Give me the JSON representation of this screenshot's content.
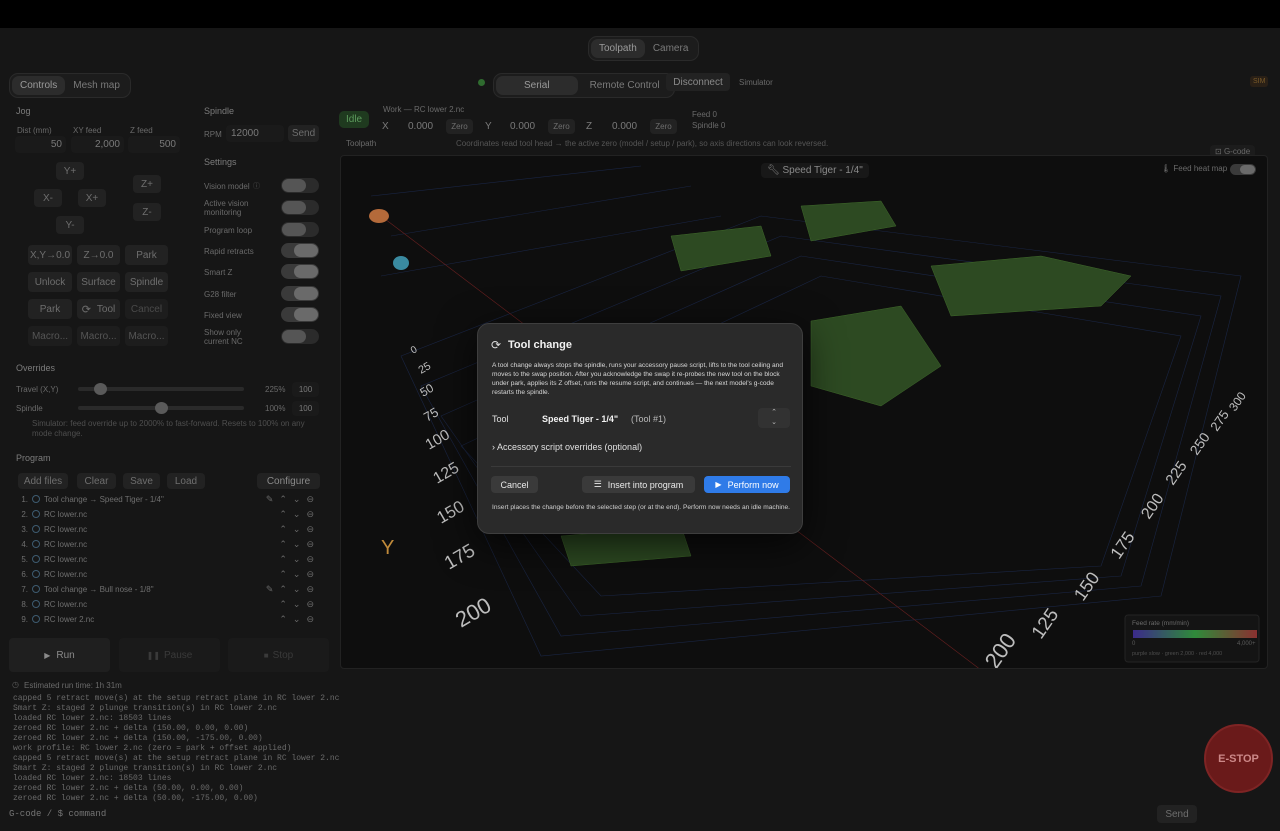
{
  "view_tabs": [
    "Toolpath",
    "Camera"
  ],
  "left_tabs": [
    "Controls",
    "Mesh map"
  ],
  "connection": {
    "tabs": [
      "Serial",
      "Remote Control"
    ],
    "disconnect": "Disconnect",
    "mode": "Simulator",
    "badge": "SIM"
  },
  "jog": {
    "title": "Jog",
    "dist_label": "Dist (mm)",
    "xy_label": "XY feed",
    "z_label": "Z feed",
    "dist": "50",
    "xy": "2,000",
    "z": "500",
    "axes": [
      "Y+",
      "X-",
      "X+",
      "Y-",
      "Z+",
      "Z-"
    ],
    "buttons": [
      "X,Y→0.0",
      "Z→0.0",
      "Park",
      "Unlock",
      "Surface",
      "Spindle",
      "Park",
      "Tool",
      "Cancel",
      "Macro...",
      "Macro...",
      "Macro..."
    ]
  },
  "spindle": {
    "title": "Spindle",
    "rpm_label": "RPM",
    "rpm": "12000",
    "send": "Send"
  },
  "settings": {
    "title": "Settings",
    "items": [
      "Vision model",
      "Active vision monitoring",
      "Program loop",
      "Rapid retracts",
      "Smart Z",
      "G28 filter",
      "Fixed view",
      "Show only current NC"
    ]
  },
  "overrides": {
    "title": "Overrides",
    "travel_label": "Travel (X,Y)",
    "travel_pct": "225%",
    "travel_val": "100",
    "spindle_label": "Spindle",
    "spindle_pct": "100%",
    "spindle_val": "100",
    "note": "Simulator: feed override up to 2000% to fast-forward. Resets to 100% on any mode change."
  },
  "program": {
    "title": "Program",
    "buttons": [
      "Add files",
      "Clear",
      "Save",
      "Load"
    ],
    "configure": "Configure",
    "rows": [
      {
        "n": "1.",
        "t": "Tool change → Speed Tiger - 1/4\""
      },
      {
        "n": "2.",
        "t": "RC lower.nc"
      },
      {
        "n": "3.",
        "t": "RC lower.nc"
      },
      {
        "n": "4.",
        "t": "RC lower.nc"
      },
      {
        "n": "5.",
        "t": "RC lower.nc"
      },
      {
        "n": "6.",
        "t": "RC lower.nc"
      },
      {
        "n": "7.",
        "t": "Tool change → Bull nose - 1/8\""
      },
      {
        "n": "8.",
        "t": "RC lower.nc"
      },
      {
        "n": "9.",
        "t": "RC lower 2.nc"
      }
    ],
    "run": "Run",
    "pause": "Pause",
    "stop": "Stop",
    "estimate": "Estimated run time: 1h 31m"
  },
  "status": {
    "state": "Idle",
    "work": "Work — RC lower 2.nc",
    "x": "0.000",
    "y": "0.000",
    "z": "0.000",
    "zero": "Zero",
    "feed": "Feed 0",
    "spindle": "Spindle 0",
    "toolpath": "Toolpath",
    "note": "Coordinates read tool head → the active zero (model / setup / park), so axis directions can look reversed.",
    "gcode": "G-code"
  },
  "viewport": {
    "tool_label": "Speed Tiger - 1/4\"",
    "heatmap": "Feed heat map",
    "legend_title": "Feed rate (mm/min)",
    "legend_min": "0",
    "legend_max": "4,000+",
    "legend_note": "purple slow · green 2,000 · red 4,000",
    "ticks_left": [
      "0",
      "25",
      "50",
      "75",
      "100",
      "125",
      "150",
      "175",
      "200"
    ],
    "ticks_bottom": [
      "200",
      "125",
      "150",
      "175",
      "200",
      "225",
      "250",
      "275",
      "300"
    ]
  },
  "modal": {
    "title": "Tool change",
    "desc": "A tool change always stops the spindle, runs your accessory pause script, lifts to the tool ceiling and moves to the swap position. After you acknowledge the swap it re-probes the new tool on the block under park, applies its Z offset, runs the resume script, and continues — the next model's g-code restarts the spindle.",
    "tool_label": "Tool",
    "tool_name": "Speed Tiger - 1/4\"",
    "tool_num": "(Tool #1)",
    "accessory": "Accessory script overrides (optional)",
    "cancel": "Cancel",
    "insert": "Insert into program",
    "perform": "Perform now",
    "footer": "Insert places the change before the selected step (or at the end). Perform now needs an idle machine."
  },
  "console": {
    "lines": [
      "capped 5 retract move(s) at the setup retract plane in RC lower 2.nc",
      "Smart Z: staged 2 plunge transition(s) in RC lower 2.nc",
      "loaded RC lower 2.nc: 18503 lines",
      "zeroed RC lower 2.nc + delta (150.00, 0.00, 0.00)",
      "zeroed RC lower 2.nc + delta (150.00, -175.00, 0.00)",
      "work profile: RC lower 2.nc (zero = park + offset applied)",
      "capped 5 retract move(s) at the setup retract plane in RC lower 2.nc",
      "Smart Z: staged 2 plunge transition(s) in RC lower 2.nc",
      "loaded RC lower 2.nc: 18503 lines",
      "zeroed RC lower 2.nc + delta (50.00, 0.00, 0.00)",
      "zeroed RC lower 2.nc + delta (50.00, -175.00, 0.00)"
    ],
    "placeholder": "G-code / $ command",
    "send": "Send",
    "estop": "E-STOP"
  }
}
